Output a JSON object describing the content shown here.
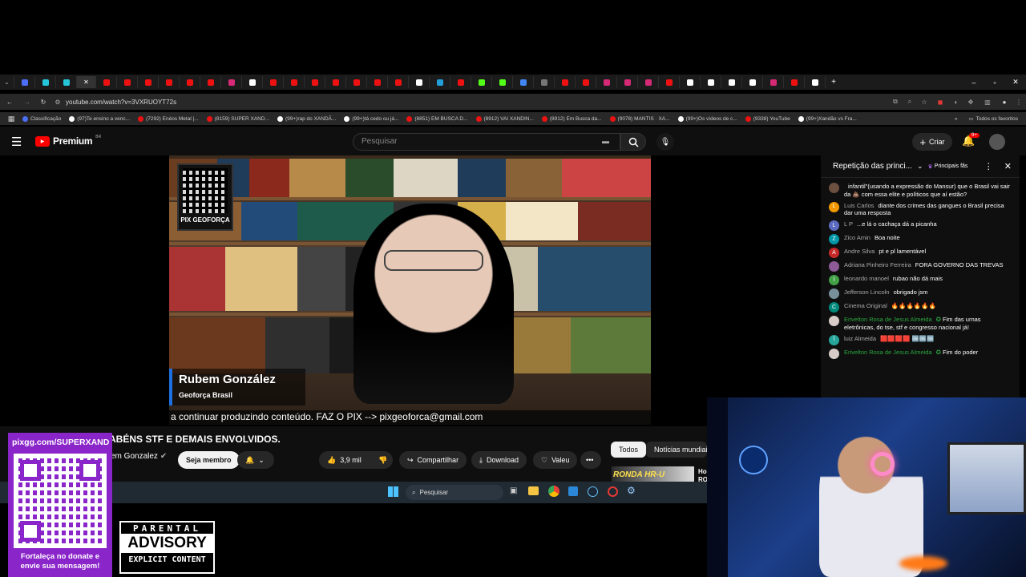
{
  "browser": {
    "url": "youtube.com/watch?v=3VXRUOYT72s",
    "bookmarks": [
      "Classificação",
      "(97)Te ensino a venc...",
      "(7292) Enéos Metal |...",
      "(8159) SUPER XAND...",
      "(99+)rap do XANDÃ...",
      "(99+)tá cedo ou já...",
      "(8851) EM BUSCA D...",
      "(8912) VAI XANDIN...",
      "(8912) Em Busca da...",
      "(9078) MANTIS · XA...",
      "(99+)Os vídeos de c...",
      "(9338) YouTube",
      "(99+)Xandão vs Fra..."
    ],
    "all_bookmarks": "Todos os favoritos"
  },
  "youtube": {
    "logo": "Premium",
    "region": "BR",
    "search_placeholder": "Pesquisar",
    "create_label": "Criar",
    "notif_count": "9+"
  },
  "video": {
    "qr_label": "PIX GEOFORÇA",
    "lower_third_name": "Rubem González",
    "lower_third_sub": "Geoforça Brasil",
    "caption": "a continuar produzindo conteúdo. FAZ O PIX --> pixgeoforca@gmail.com"
  },
  "info": {
    "title": "ABÉNS STF E DEMAIS ENVOLVIDOS.",
    "channel": "em Gonzalez",
    "join": "Seja membro",
    "likes": "3,9 mil",
    "share": "Compartilhar",
    "download": "Download",
    "thanks": "Valeu",
    "chip_all": "Todos",
    "chip_news": "Notícias mundiais",
    "rec_title": "Ho",
    "rec_sub": "RO",
    "rec_thumb": "RONDA HR-U"
  },
  "chat": {
    "title": "Repetição das princi...",
    "top_fans": "Principais fãs",
    "messages": [
      {
        "author": "",
        "text": "infantil\"(usando a expressão do Mansur) que o Brasil vai sair da 💩 com essa elite e políticos que aí estão?",
        "color": "#6b4f3f",
        "initial": ""
      },
      {
        "author": "Luis Carlos",
        "text": "diante dos crimes das gangues o Brasil precisa dar uma resposta",
        "color": "#f29900",
        "initial": "L"
      },
      {
        "author": "L P",
        "text": "...e lá o cachaça dá a picanha",
        "color": "#5c6bc0",
        "initial": "L"
      },
      {
        "author": "Zico Amin",
        "text": "Boa noite",
        "color": "#0097a7",
        "initial": "Z"
      },
      {
        "author": "Andre Silva",
        "text": "pt e pl lamentável",
        "color": "#c62828",
        "initial": "A"
      },
      {
        "author": "Adriana Pinheiro Ferreira",
        "text": "FORA GOVERNO DAS TREVAS",
        "color": "#8d5a97",
        "initial": ""
      },
      {
        "author": "leonardo manoel",
        "text": "rubao não dá mais",
        "color": "#43a047",
        "initial": "l"
      },
      {
        "author": "Jefferson Lincoln",
        "text": "obrigado jsm",
        "color": "#78909c",
        "initial": ""
      },
      {
        "author": "Cinema Original",
        "text": "🔥🔥🔥🔥🔥🔥",
        "color": "#00897b",
        "initial": "C"
      },
      {
        "author": "Erivelton Rosa de Jesus Almeida",
        "text": "Fim das urnas eletrônicas, do tse, stf e congresso nacional já!",
        "color": "#d7ccc8",
        "initial": "",
        "mod": true
      },
      {
        "author": "luiz Almeida",
        "text": "🟥🟥🟥🟥 🆒🆒🆒",
        "color": "#26a69a",
        "initial": "l"
      },
      {
        "author": "Erivelton Rosa de Jesus Almeida",
        "text": "Fim do poder",
        "color": "#d7ccc8",
        "initial": "",
        "mod": true
      }
    ]
  },
  "taskbar": {
    "search": "Pesquisar"
  },
  "overlay": {
    "pix_url": "pixgg.com/SUPERXAND",
    "donate_text": "Fortaleça no donate e envie sua mensagem!",
    "advisory_top": "PARENTAL",
    "advisory_mid": "ADVISORY",
    "advisory_bottom": "EXPLICIT CONTENT"
  }
}
